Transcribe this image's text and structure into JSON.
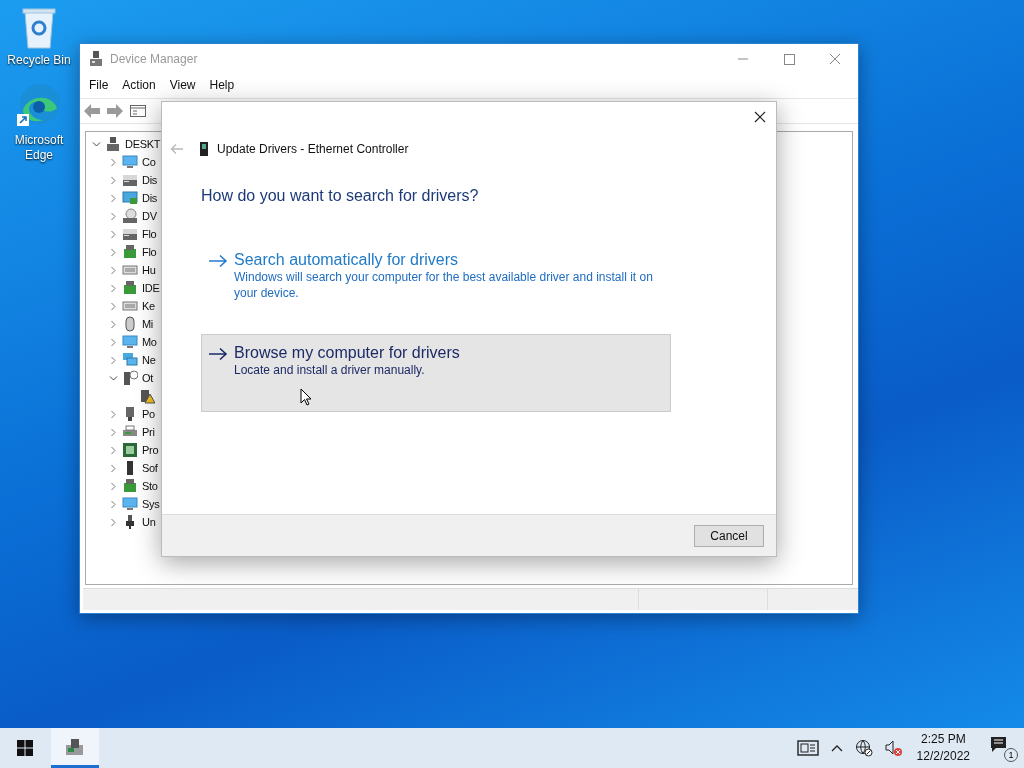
{
  "desktop_icons": [
    {
      "label": "Recycle Bin",
      "kind": "recycle"
    },
    {
      "label": "Microsoft Edge",
      "kind": "edge"
    }
  ],
  "device_manager": {
    "title": "Device Manager",
    "menu": [
      "File",
      "Action",
      "View",
      "Help"
    ],
    "tree": [
      {
        "label": "DESKT",
        "kind": "computer",
        "expanded": true,
        "children": [
          {
            "label": "Co",
            "kind": "monitor",
            "expanded": false
          },
          {
            "label": "Dis",
            "kind": "drive",
            "expanded": false
          },
          {
            "label": "Dis",
            "kind": "display",
            "expanded": false
          },
          {
            "label": "DV",
            "kind": "dvd",
            "expanded": false
          },
          {
            "label": "Flo",
            "kind": "drive",
            "expanded": false
          },
          {
            "label": "Flo",
            "kind": "chip",
            "expanded": false
          },
          {
            "label": "Hu",
            "kind": "keyboard",
            "expanded": false
          },
          {
            "label": "IDE",
            "kind": "chip",
            "expanded": false
          },
          {
            "label": "Ke",
            "kind": "keyboard",
            "expanded": false
          },
          {
            "label": "Mi",
            "kind": "mouse",
            "expanded": false
          },
          {
            "label": "Mo",
            "kind": "monitor",
            "expanded": false
          },
          {
            "label": "Ne",
            "kind": "network",
            "expanded": false
          },
          {
            "label": "Ot",
            "kind": "unknown",
            "expanded": true,
            "children": [
              {
                "kind": "warning"
              }
            ]
          },
          {
            "label": "Po",
            "kind": "port",
            "expanded": false
          },
          {
            "label": "Pri",
            "kind": "printer",
            "expanded": false
          },
          {
            "label": "Pro",
            "kind": "cpu",
            "expanded": false
          },
          {
            "label": "Sof",
            "kind": "tower",
            "expanded": false
          },
          {
            "label": "Sto",
            "kind": "chip",
            "expanded": false
          },
          {
            "label": "Sys",
            "kind": "monitor",
            "expanded": false
          },
          {
            "label": "Un",
            "kind": "usb",
            "expanded": false
          }
        ]
      }
    ]
  },
  "dialog": {
    "title": "Update Drivers - Ethernet Controller",
    "back": {
      "disabled": true
    },
    "heading": "How do you want to search for drivers?",
    "options": [
      {
        "title": "Search automatically for drivers",
        "description": "Windows will search your computer for the best available driver and install it on your device.",
        "selected": false
      },
      {
        "title": "Browse my computer for drivers",
        "description": "Locate and install a driver manually.",
        "selected": true
      }
    ],
    "buttons": [
      "Cancel"
    ]
  },
  "taskbar": {
    "apps": [
      {
        "kind": "device-manager",
        "active": true
      }
    ],
    "tray": {
      "time": "2:25 PM",
      "date": "12/2/2022",
      "notification_count": "1"
    }
  }
}
